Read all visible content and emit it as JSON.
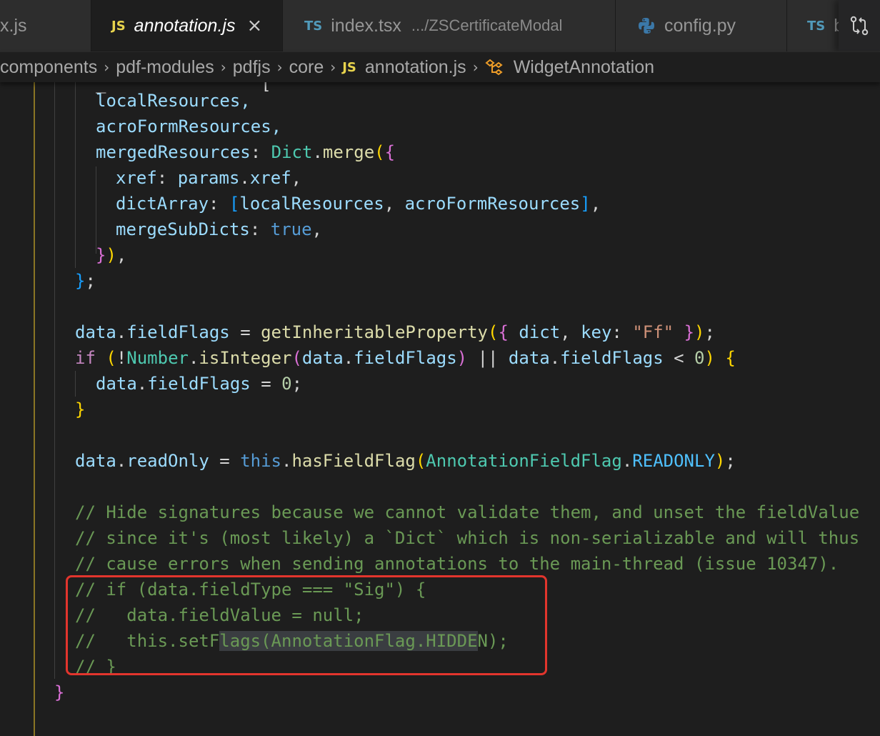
{
  "tabs": [
    {
      "badge": "",
      "label": "x.js",
      "italic": false,
      "active": false
    },
    {
      "badge": "JS",
      "label": "annotation.js",
      "italic": true,
      "active": true,
      "close": "×"
    },
    {
      "badge": "TS",
      "label": "index.tsx",
      "description": ".../ZSCertificateModal",
      "active": false
    },
    {
      "badge": "",
      "label": "config.py",
      "icon": "python-icon",
      "active": false
    },
    {
      "badge": "TS",
      "label": "b",
      "active": false
    }
  ],
  "breadcrumb": [
    {
      "label": "components"
    },
    {
      "label": "pdf-modules"
    },
    {
      "label": "pdfjs"
    },
    {
      "label": "core"
    },
    {
      "label": "annotation.js",
      "badge": "JS"
    },
    {
      "label": "WidgetAnnotation",
      "icon": "symbol-class-icon"
    }
  ],
  "colors": {
    "background": "#1e1e1e",
    "tabbar": "#252526",
    "comment": "#6a9955",
    "highlight_box": "#e2352d",
    "indent_guide_active": "#8a7524"
  },
  "code": {
    "line_1": "localResources,",
    "line_2": "acroFormResources,",
    "line_3_key": "mergedResources",
    "line_3_obj": "Dict",
    "line_3_fn": "merge",
    "line_4_key": "xref",
    "line_4_obj": "params",
    "line_4_prop": "xref",
    "line_5_key": "dictArray",
    "line_5_a": "localResources",
    "line_5_b": "acroFormResources",
    "line_6_key": "mergeSubDicts",
    "line_6_val": "true",
    "line_9_obj": "data",
    "line_9_prop": "fieldFlags",
    "line_9_fn": "getInheritableProperty",
    "line_9_dict": "dict",
    "line_9_key": "key",
    "line_9_str": "\"Ff\"",
    "line_10_kw": "if",
    "line_10_cls": "Number",
    "line_10_fn": "isInteger",
    "line_10_obj": "data",
    "line_10_prop": "fieldFlags",
    "line_10_num": "0",
    "line_11_obj": "data",
    "line_11_prop": "fieldFlags",
    "line_11_num": "0",
    "line_14_obj": "data",
    "line_14_prop": "readOnly",
    "line_14_this": "this",
    "line_14_fn": "hasFieldFlag",
    "line_14_cls": "AnnotationFieldFlag",
    "line_14_const": "READONLY",
    "comment_1": "// Hide signatures because we cannot validate them, and unset the fieldValue",
    "comment_2": "// since it's (most likely) a `Dict` which is non-serializable and will thus",
    "comment_3": "// cause errors when sending annotations to the main-thread (issue 10347).",
    "comment_4": "// if (data.fieldType === \"Sig\") {",
    "comment_5": "//   data.fieldValue = null;",
    "comment_6a": "//   this.setF",
    "comment_6b": "lags(AnnotationFlag.HIDDE",
    "comment_6c": "N);",
    "comment_7": "// }"
  }
}
